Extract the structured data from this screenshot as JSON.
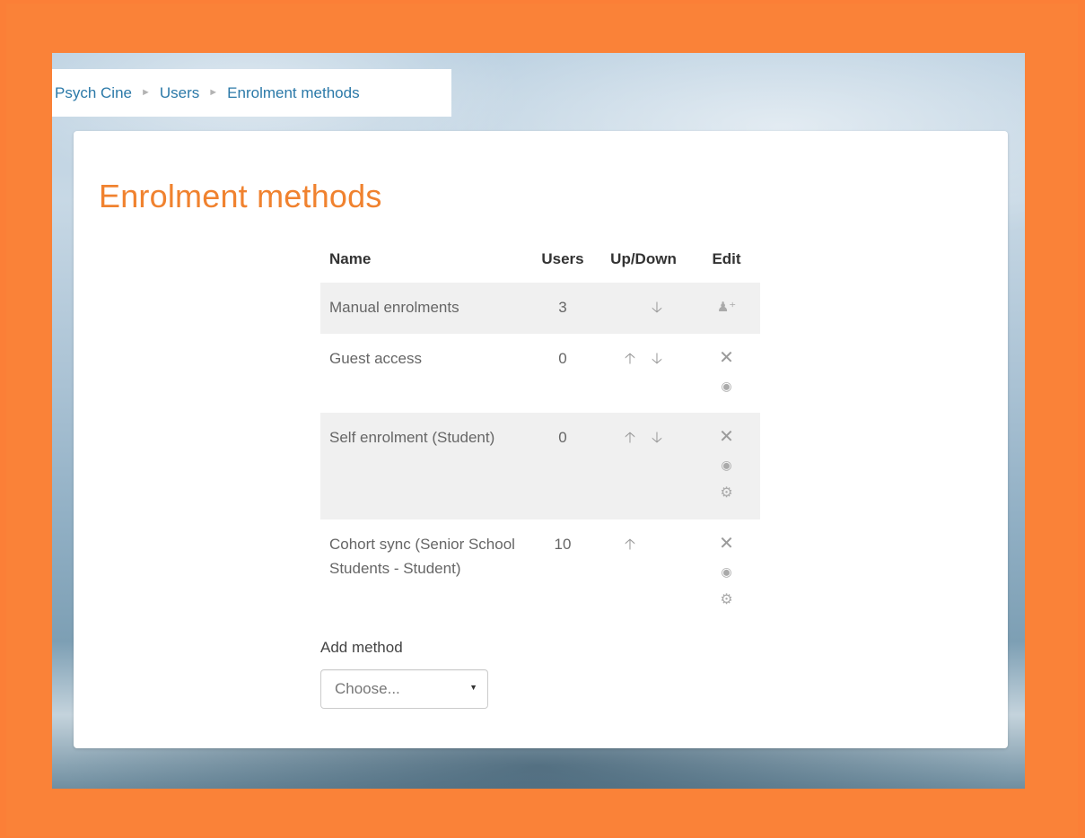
{
  "breadcrumb": {
    "items": [
      "Psych Cine",
      "Users",
      "Enrolment methods"
    ],
    "separator": "►"
  },
  "page": {
    "title": "Enrolment methods"
  },
  "table": {
    "headers": {
      "name": "Name",
      "users": "Users",
      "updown": "Up/Down",
      "edit": "Edit"
    },
    "rows": [
      {
        "name": "Manual enrolments",
        "users": "3",
        "up": false,
        "down": true,
        "edit_icons": [
          "enrol-users-icon"
        ]
      },
      {
        "name": "Guest access",
        "users": "0",
        "up": true,
        "down": true,
        "edit_icons": [
          "delete-icon",
          "hide-icon"
        ]
      },
      {
        "name": "Self enrolment (Student)",
        "users": "0",
        "up": true,
        "down": true,
        "edit_icons": [
          "delete-icon",
          "hide-icon",
          "settings-icon"
        ]
      },
      {
        "name": "Cohort sync (Senior School Students - Student)",
        "users": "10",
        "up": true,
        "down": false,
        "edit_icons": [
          "delete-icon",
          "hide-icon",
          "settings-icon"
        ]
      }
    ]
  },
  "add_method": {
    "label": "Add method",
    "selected": "Choose..."
  },
  "colors": {
    "accent": "#f0822f",
    "link": "#2b79a8",
    "frame": "#fa8238"
  }
}
